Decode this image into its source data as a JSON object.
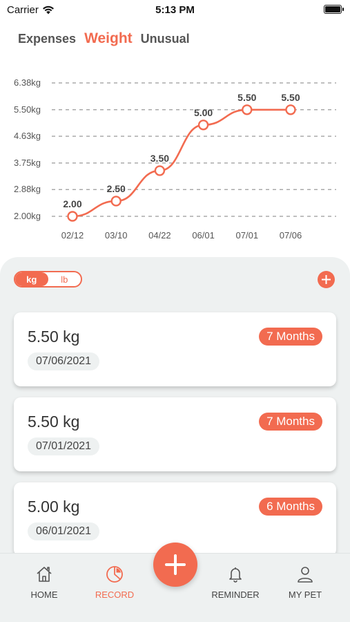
{
  "status_bar": {
    "carrier": "Carrier",
    "time": "5:13 PM"
  },
  "tabs": [
    {
      "label": "Expenses",
      "active": false
    },
    {
      "label": "Weight",
      "active": true
    },
    {
      "label": "Unusual",
      "active": false
    }
  ],
  "chart_data": {
    "type": "line",
    "x": [
      "02/12",
      "03/10",
      "04/22",
      "06/01",
      "07/01",
      "07/06"
    ],
    "values": [
      2.0,
      2.5,
      3.5,
      5.0,
      5.5,
      5.5
    ],
    "data_labels": [
      "2.00",
      "2.50",
      "3.50",
      "5.00",
      "5.50",
      "5.50"
    ],
    "y_ticks": [
      "2.00kg",
      "2.88kg",
      "3.75kg",
      "4.63kg",
      "5.50kg",
      "6.38kg"
    ],
    "y_tick_values": [
      2.0,
      2.88,
      3.75,
      4.63,
      5.5,
      6.38
    ],
    "ylim": [
      2.0,
      6.38
    ],
    "grid": true,
    "grid_style": "dashed",
    "line_color": "#f26b50"
  },
  "unit_toggle": {
    "options": [
      "kg",
      "lb"
    ],
    "selected": "kg"
  },
  "records": [
    {
      "weight": "5.50 kg",
      "date": "07/06/2021",
      "age": "7 Months"
    },
    {
      "weight": "5.50 kg",
      "date": "07/01/2021",
      "age": "7 Months"
    },
    {
      "weight": "5.00 kg",
      "date": "06/01/2021",
      "age": "6 Months"
    }
  ],
  "nav": {
    "home": "HOME",
    "record": "RECORD",
    "reminder": "REMINDER",
    "my_pet": "MY PET",
    "active": "record"
  },
  "colors": {
    "accent": "#f26b50",
    "panel": "#eef1f1",
    "text": "#333333",
    "grid": "#999999"
  },
  "icons": [
    "wifi-icon",
    "battery-icon",
    "plus-icon",
    "home-icon",
    "pie-chart-icon",
    "bell-icon",
    "person-icon"
  ]
}
